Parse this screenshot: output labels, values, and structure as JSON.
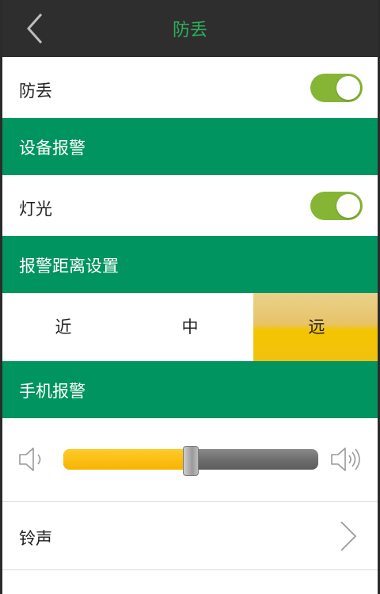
{
  "header": {
    "title": "防丢"
  },
  "anti_lost": {
    "label": "防丢",
    "enabled": true
  },
  "device_alarm": {
    "section_title": "设备报警",
    "light": {
      "label": "灯光",
      "enabled": true
    }
  },
  "alarm_distance": {
    "section_title": "报警距离设置",
    "options": [
      {
        "label": "近",
        "selected": false
      },
      {
        "label": "中",
        "selected": false
      },
      {
        "label": "远",
        "selected": true
      }
    ]
  },
  "phone_alarm": {
    "section_title": "手机报警",
    "volume_level": 0.5,
    "ringtone": {
      "label": "铃声"
    }
  },
  "colors": {
    "header_bg": "#2e2e2e",
    "title_green": "#2fae5c",
    "section_green": "#009460",
    "toggle_green": "#86b536",
    "selected_gold": "#f3c400",
    "slider_fill": "#f7b400"
  },
  "icons": [
    "back-arrow-icon",
    "volume-low-icon",
    "volume-high-icon",
    "chevron-right-icon"
  ]
}
